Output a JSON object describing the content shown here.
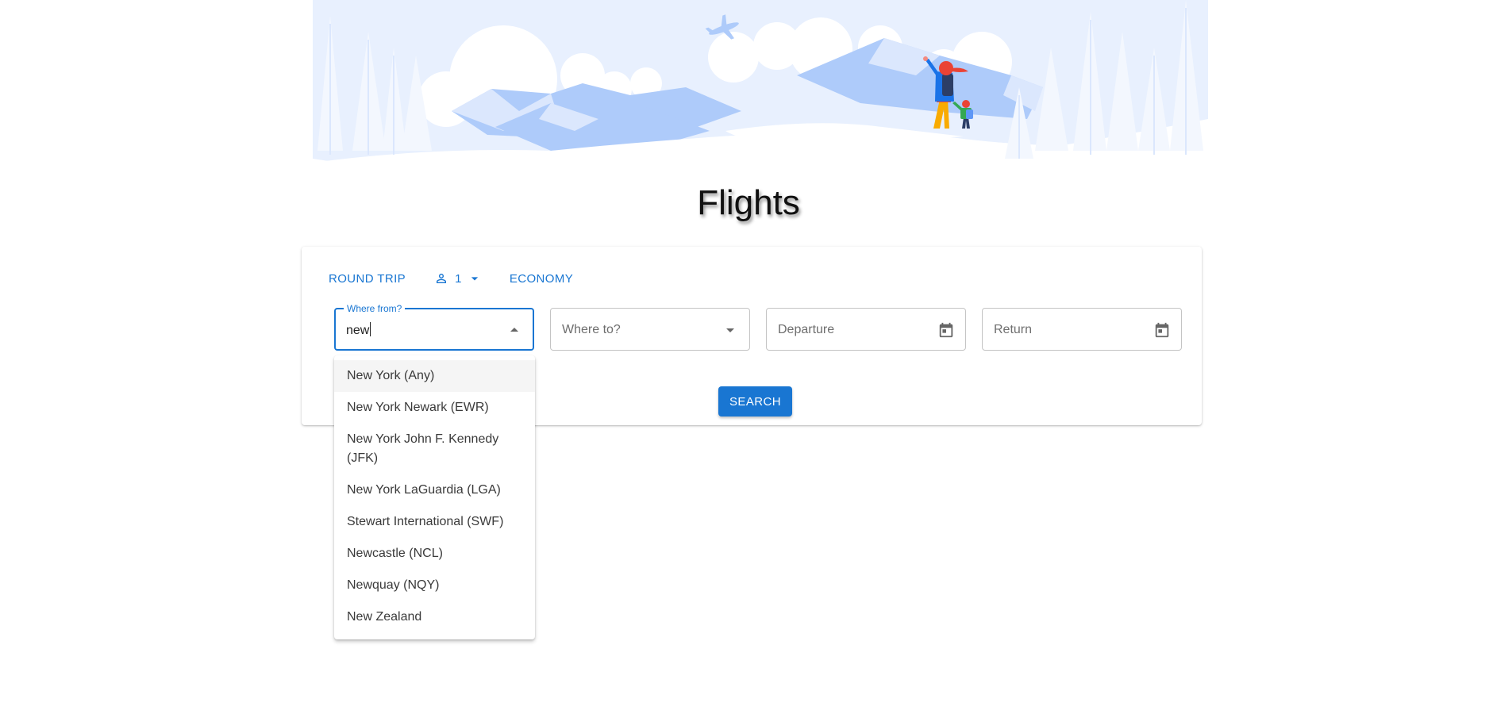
{
  "page": {
    "title": "Flights"
  },
  "trip_options": {
    "trip_type": "ROUND TRIP",
    "passengers": "1",
    "cabin_class": "ECONOMY"
  },
  "fields": {
    "from": {
      "label": "Where from?",
      "value": "new"
    },
    "to": {
      "placeholder": "Where to?"
    },
    "departure": {
      "placeholder": "Departure"
    },
    "return": {
      "placeholder": "Return"
    }
  },
  "search_button": {
    "label": "SEARCH"
  },
  "suggestions": [
    "New York (Any)",
    "New York Newark (EWR)",
    "New York John F. Kennedy (JFK)",
    "New York LaGuardia (LGA)",
    "Stewart International (SWF)",
    "Newcastle (NCL)",
    "Newquay (NQY)",
    "New Zealand"
  ],
  "colors": {
    "accent": "#1976d2",
    "illustration_light": "#e8f0fe",
    "illustration_mid": "#aecbfa"
  },
  "icons": {
    "passenger": "person-outline-icon",
    "dropdown": "arrow-drop-down-icon",
    "collapse": "arrow-drop-up-icon",
    "calendar": "calendar-icon"
  }
}
